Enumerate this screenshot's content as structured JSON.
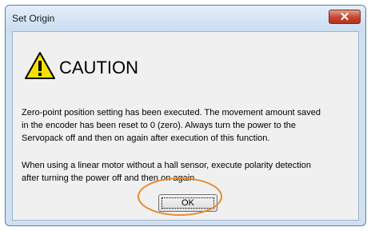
{
  "dialog": {
    "title": "Set Origin",
    "close_icon": "close-icon",
    "warning_icon": "warning-triangle-icon",
    "heading": "CAUTION",
    "message_lines": [
      "Zero-point position setting has been executed. The movement amount saved",
      "in the encoder has been reset to 0 (zero). Always turn the power to the",
      "Servopack off and then on again after execution of this function."
    ],
    "note_lines": [
      "When using a linear motor without a hall sensor, execute polarity detection",
      "after turning the power off and then on again"
    ],
    "ok_label": "OK"
  },
  "colors": {
    "highlight_ring": "#e58a2c",
    "close_button": "#c44730",
    "warning_fill": "#f7e000"
  }
}
